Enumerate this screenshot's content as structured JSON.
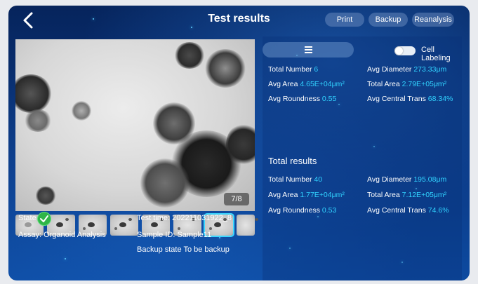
{
  "header": {
    "title": "Test results",
    "buttons": {
      "print": "Print",
      "backup": "Backup",
      "reanalysis": "Reanalysis"
    }
  },
  "image_viewer": {
    "counter": "7/8",
    "thumbnail_count": 8,
    "active_thumbnail": 7
  },
  "info": {
    "state_label": "State",
    "assay": "Assay: Organoid Analysis",
    "test_time": "Test time: 202211031922_8",
    "sample_id": "Sample ID: Sample11",
    "backup_state": "Backup state To be backup"
  },
  "controls": {
    "cell_labeling_label": "Cell Labeling",
    "cell_labeling_on": false
  },
  "current_results": {
    "total_number_label": "Total Number",
    "total_number": "6",
    "avg_diameter_label": "Avg Diameter",
    "avg_diameter": "273.33μm",
    "avg_area_label": "Avg Area",
    "avg_area": "4.65E+04μm²",
    "total_area_label": "Total Area",
    "total_area": "2.79E+05μm²",
    "avg_roundness_label": "Avg Roundness",
    "avg_roundness": "0.55",
    "avg_central_trans_label": "Avg Central Trans",
    "avg_central_trans": "68.34%"
  },
  "total_results": {
    "title": "Total results",
    "total_number_label": "Total Number",
    "total_number": "40",
    "avg_diameter_label": "Avg Diameter",
    "avg_diameter": "195.08μm",
    "avg_area_label": "Avg Area",
    "avg_area": "1.77E+04μm²",
    "total_area_label": "Total Area",
    "total_area": "7.12E+05μm²",
    "avg_roundness_label": "Avg Roundness",
    "avg_roundness": "0.53",
    "avg_central_trans_label": "Avg Central Trans",
    "avg_central_trans": "74.6%"
  },
  "colors": {
    "value_accent": "#31d3ff",
    "check_green": "#2fb548",
    "background": "#0b3a86"
  }
}
